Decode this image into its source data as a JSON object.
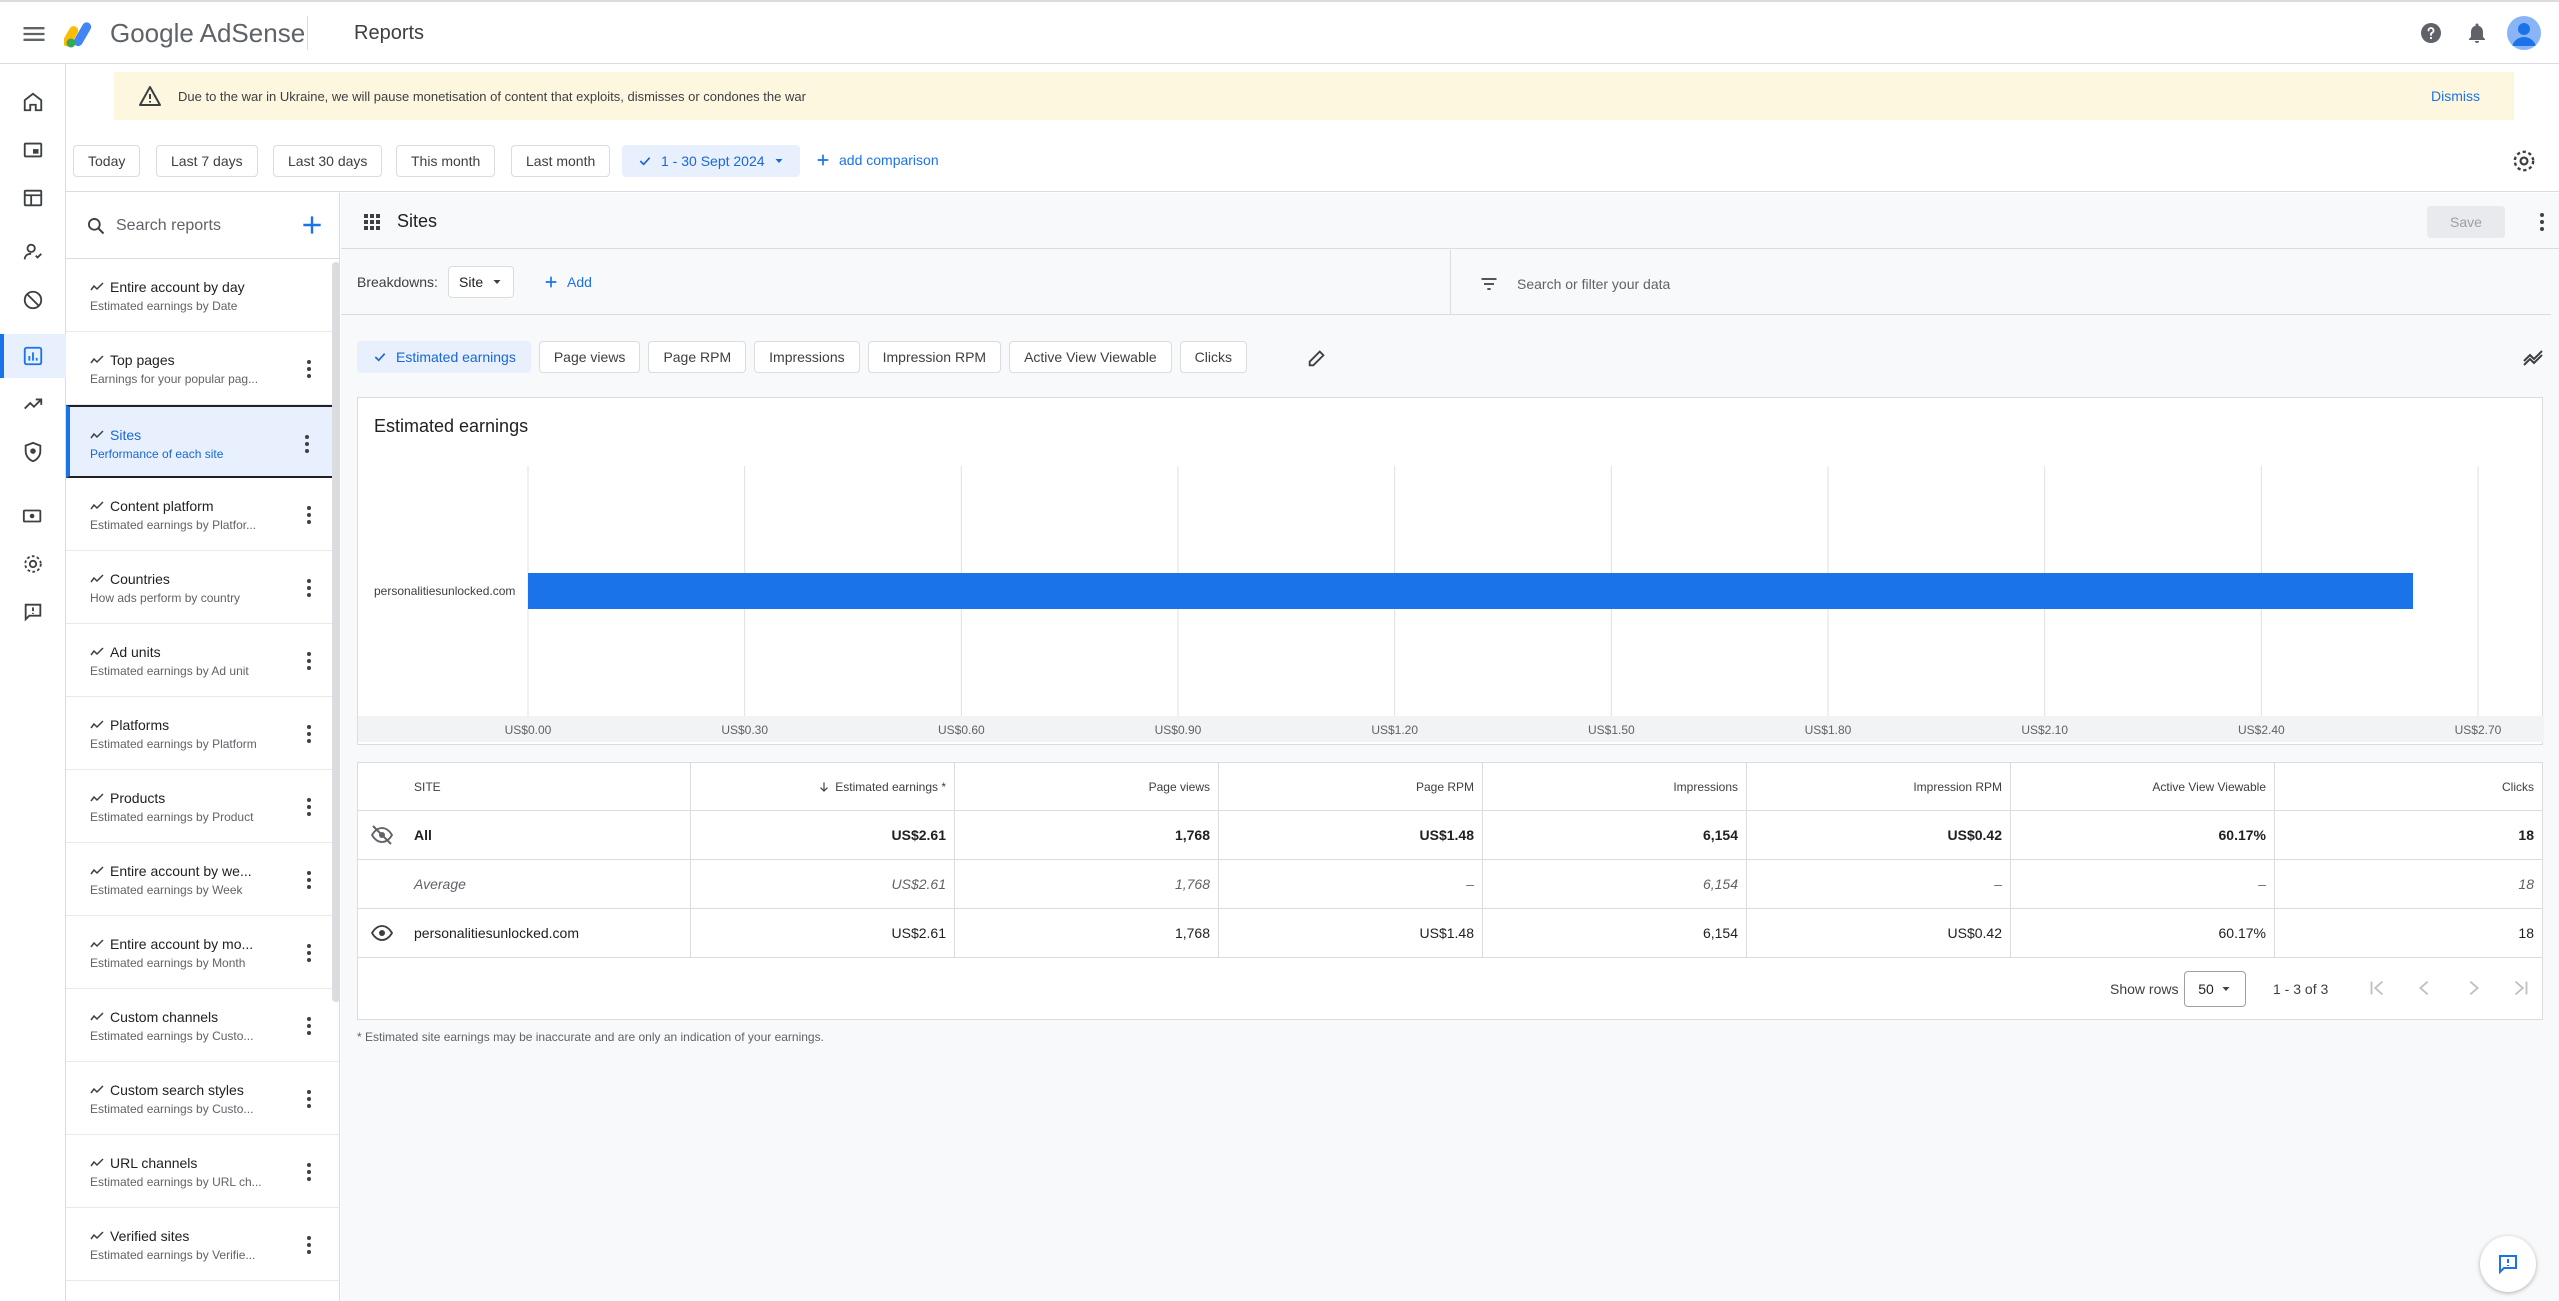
{
  "header": {
    "product": "Google AdSense",
    "page_title": "Reports"
  },
  "banner": {
    "text": "Due to the war in Ukraine, we will pause monetisation of content that exploits, dismisses or condones the war",
    "dismiss": "Dismiss"
  },
  "date_range": {
    "chips": [
      "Today",
      "Last 7 days",
      "Last 30 days",
      "This month",
      "Last month"
    ],
    "selected": "1 - 30 Sept 2024",
    "add_comparison": "add comparison"
  },
  "reports": {
    "search_placeholder": "Search reports",
    "items": [
      {
        "title": "Entire account by day",
        "sub": "Estimated earnings by Date"
      },
      {
        "title": "Top pages",
        "sub": "Earnings for your popular pag..."
      },
      {
        "title": "Sites",
        "sub": "Performance of each site"
      },
      {
        "title": "Content platform",
        "sub": "Estimated earnings by Platfor..."
      },
      {
        "title": "Countries",
        "sub": "How ads perform by country"
      },
      {
        "title": "Ad units",
        "sub": "Estimated earnings by Ad unit"
      },
      {
        "title": "Platforms",
        "sub": "Estimated earnings by Platform"
      },
      {
        "title": "Products",
        "sub": "Estimated earnings by Product"
      },
      {
        "title": "Entire account by we...",
        "sub": "Estimated earnings by Week"
      },
      {
        "title": "Entire account by mo...",
        "sub": "Estimated earnings by Month"
      },
      {
        "title": "Custom channels",
        "sub": "Estimated earnings by Custo..."
      },
      {
        "title": "Custom search styles",
        "sub": "Estimated earnings by Custo..."
      },
      {
        "title": "URL channels",
        "sub": "Estimated earnings by URL ch..."
      },
      {
        "title": "Verified sites",
        "sub": "Estimated earnings by Verifie..."
      }
    ]
  },
  "report": {
    "title": "Sites",
    "save": "Save",
    "breakdowns_label": "Breakdowns:",
    "breakdown_value": "Site",
    "add": "Add",
    "filter_placeholder": "Search or filter your data",
    "metrics": [
      "Estimated earnings",
      "Page views",
      "Page RPM",
      "Impressions",
      "Impression RPM",
      "Active View Viewable",
      "Clicks"
    ]
  },
  "chart_data": {
    "type": "bar",
    "orientation": "horizontal",
    "title": "Estimated earnings",
    "categories": [
      "personalitiesunlocked.com"
    ],
    "values": [
      2.61
    ],
    "xlim": [
      0,
      2.7
    ],
    "xticks": [
      "US$0.00",
      "US$0.30",
      "US$0.60",
      "US$0.90",
      "US$1.20",
      "US$1.50",
      "US$1.80",
      "US$2.10",
      "US$2.40",
      "US$2.70"
    ],
    "bar_color": "#1a73e8",
    "grid": true
  },
  "table": {
    "columns": [
      "SITE",
      "Estimated earnings *",
      "Page views",
      "Page RPM",
      "Impressions",
      "Impression RPM",
      "Active View Viewable",
      "Clicks"
    ],
    "rows": [
      {
        "label": "All",
        "values": [
          "US$2.61",
          "1,768",
          "US$1.48",
          "6,154",
          "US$0.42",
          "60.17%",
          "18"
        ]
      },
      {
        "label": "Average",
        "values": [
          "US$2.61",
          "1,768",
          "–",
          "6,154",
          "–",
          "–",
          "18"
        ]
      },
      {
        "label": "personalitiesunlocked.com",
        "values": [
          "US$2.61",
          "1,768",
          "US$1.48",
          "6,154",
          "US$0.42",
          "60.17%",
          "18"
        ]
      }
    ],
    "show_rows_label": "Show rows",
    "rows_per_page": "50",
    "range_label": "1 - 3 of 3"
  },
  "footnote": "* Estimated site earnings may be inaccurate and are only an indication of your earnings."
}
